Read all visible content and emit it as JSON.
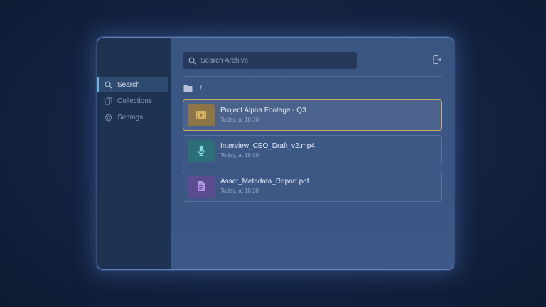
{
  "search": {
    "placeholder": "Search Archive",
    "value": ""
  },
  "sidebar": {
    "items": [
      {
        "label": "Search",
        "icon": "search-icon",
        "active": true
      },
      {
        "label": "Collections",
        "icon": "collections-icon",
        "active": false
      },
      {
        "label": "Settings",
        "icon": "gear-icon",
        "active": false
      }
    ]
  },
  "breadcrumb": {
    "path": "/"
  },
  "files": [
    {
      "name": "Project Alpha Footage - Q3",
      "date": "Today, at 18:30",
      "icon": "video-icon",
      "color": "#c9a35c",
      "selected": true
    },
    {
      "name": "Interview_CEO_Draft_v2.mp4",
      "date": "Today, at 18:00",
      "icon": "microphone-icon",
      "color": "#2e8e8c",
      "selected": false
    },
    {
      "name": "Asset_Metadata_Report.pdf",
      "date": "Today, at 18:30",
      "icon": "document-icon",
      "color": "#7d5bb0",
      "selected": false
    }
  ],
  "colors": {
    "accent": "#6ab5d6",
    "selected_border": "#c9ad62"
  }
}
